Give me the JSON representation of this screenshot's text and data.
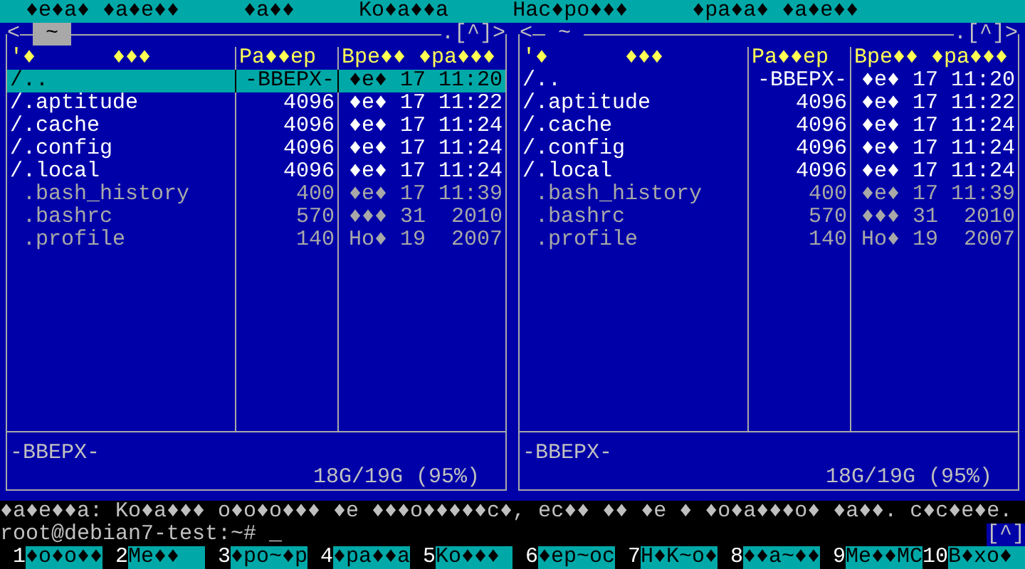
{
  "menu": [
    "♦e♦a♦ ♦a♦e♦♦",
    "♦a♦♦",
    "Ko♦a♦♦a",
    "Hac♦po♦♦♦",
    "♦pa♦a♦ ♦a♦e♦♦"
  ],
  "panels": [
    {
      "active": true,
      "left_mark": "<",
      "path": "~",
      "right_mark": ".[^]>",
      "headers": {
        "sort_mark": "'♦",
        "name": "♦♦♦",
        "size": "Pa♦♦ep",
        "time": "Bpe♦♦ ♦pa♦♦♦"
      },
      "rows": [
        {
          "name": "/..",
          "size": "-BBEPX-",
          "time": "♦e♦ 17 11:20",
          "kind": "dir",
          "selected": true
        },
        {
          "name": "/.aptitude",
          "size": "4096",
          "time": "♦e♦ 17 11:22",
          "kind": "dir",
          "selected": false
        },
        {
          "name": "/.cache",
          "size": "4096",
          "time": "♦e♦ 17 11:24",
          "kind": "dir",
          "selected": false
        },
        {
          "name": "/.config",
          "size": "4096",
          "time": "♦e♦ 17 11:24",
          "kind": "dir",
          "selected": false
        },
        {
          "name": "/.local",
          "size": "4096",
          "time": "♦e♦ 17 11:24",
          "kind": "dir",
          "selected": false
        },
        {
          "name": " .bash_history",
          "size": "400",
          "time": "♦e♦ 17 11:39",
          "kind": "file",
          "selected": false
        },
        {
          "name": " .bashrc",
          "size": "570",
          "time": "♦♦♦ 31  2010",
          "kind": "file",
          "selected": false
        },
        {
          "name": " .profile",
          "size": "140",
          "time": "Ho♦ 19  2007",
          "kind": "file",
          "selected": false
        }
      ],
      "mini_status": "-BBEPX-",
      "disk": "18G/19G (95%)"
    },
    {
      "active": false,
      "left_mark": "<",
      "path": "~",
      "right_mark": ".[^]>",
      "headers": {
        "sort_mark": "'♦",
        "name": "♦♦♦",
        "size": "Pa♦♦ep",
        "time": "Bpe♦♦ ♦pa♦♦♦"
      },
      "rows": [
        {
          "name": "/..",
          "size": "-BBEPX-",
          "time": "♦e♦ 17 11:20",
          "kind": "dir",
          "selected": false
        },
        {
          "name": "/.aptitude",
          "size": "4096",
          "time": "♦e♦ 17 11:22",
          "kind": "dir",
          "selected": false
        },
        {
          "name": "/.cache",
          "size": "4096",
          "time": "♦e♦ 17 11:24",
          "kind": "dir",
          "selected": false
        },
        {
          "name": "/.config",
          "size": "4096",
          "time": "♦e♦ 17 11:24",
          "kind": "dir",
          "selected": false
        },
        {
          "name": "/.local",
          "size": "4096",
          "time": "♦e♦ 17 11:24",
          "kind": "dir",
          "selected": false
        },
        {
          "name": " .bash_history",
          "size": "400",
          "time": "♦e♦ 17 11:39",
          "kind": "file",
          "selected": false
        },
        {
          "name": " .bashrc",
          "size": "570",
          "time": "♦♦♦ 31  2010",
          "kind": "file",
          "selected": false
        },
        {
          "name": " .profile",
          "size": "140",
          "time": "Ho♦ 19  2007",
          "kind": "file",
          "selected": false
        }
      ],
      "mini_status": "-BBEPX-",
      "disk": "18G/19G (95%)"
    }
  ],
  "hint": "♦a♦e♦♦a: Ko♦a♦♦♦ o♦o♦o♦♦♦ ♦e ♦♦♦o♦♦♦♦♦c♦, ec♦♦ ♦♦ ♦e ♦ ♦o♦a♦♦♦o♦ ♦a♦♦. c♦c♦e♦e.",
  "prompt": "root@debian7-test:~# _",
  "prompt_right": "[^]",
  "fkeys": [
    {
      "num": "1",
      "label": "♦o♦o♦♦"
    },
    {
      "num": "2",
      "label": "Me♦♦"
    },
    {
      "num": "3",
      "label": "♦po~♦p"
    },
    {
      "num": "4",
      "label": "♦pa♦♦a"
    },
    {
      "num": "5",
      "label": "Ko♦♦♦"
    },
    {
      "num": "6",
      "label": "♦ep~oc"
    },
    {
      "num": "7",
      "label": "H♦K~o♦"
    },
    {
      "num": "8",
      "label": "♦♦a~♦♦"
    },
    {
      "num": "9",
      "label": "Me♦♦MC"
    },
    {
      "num": "10",
      "label": "B♦xo♦"
    }
  ]
}
